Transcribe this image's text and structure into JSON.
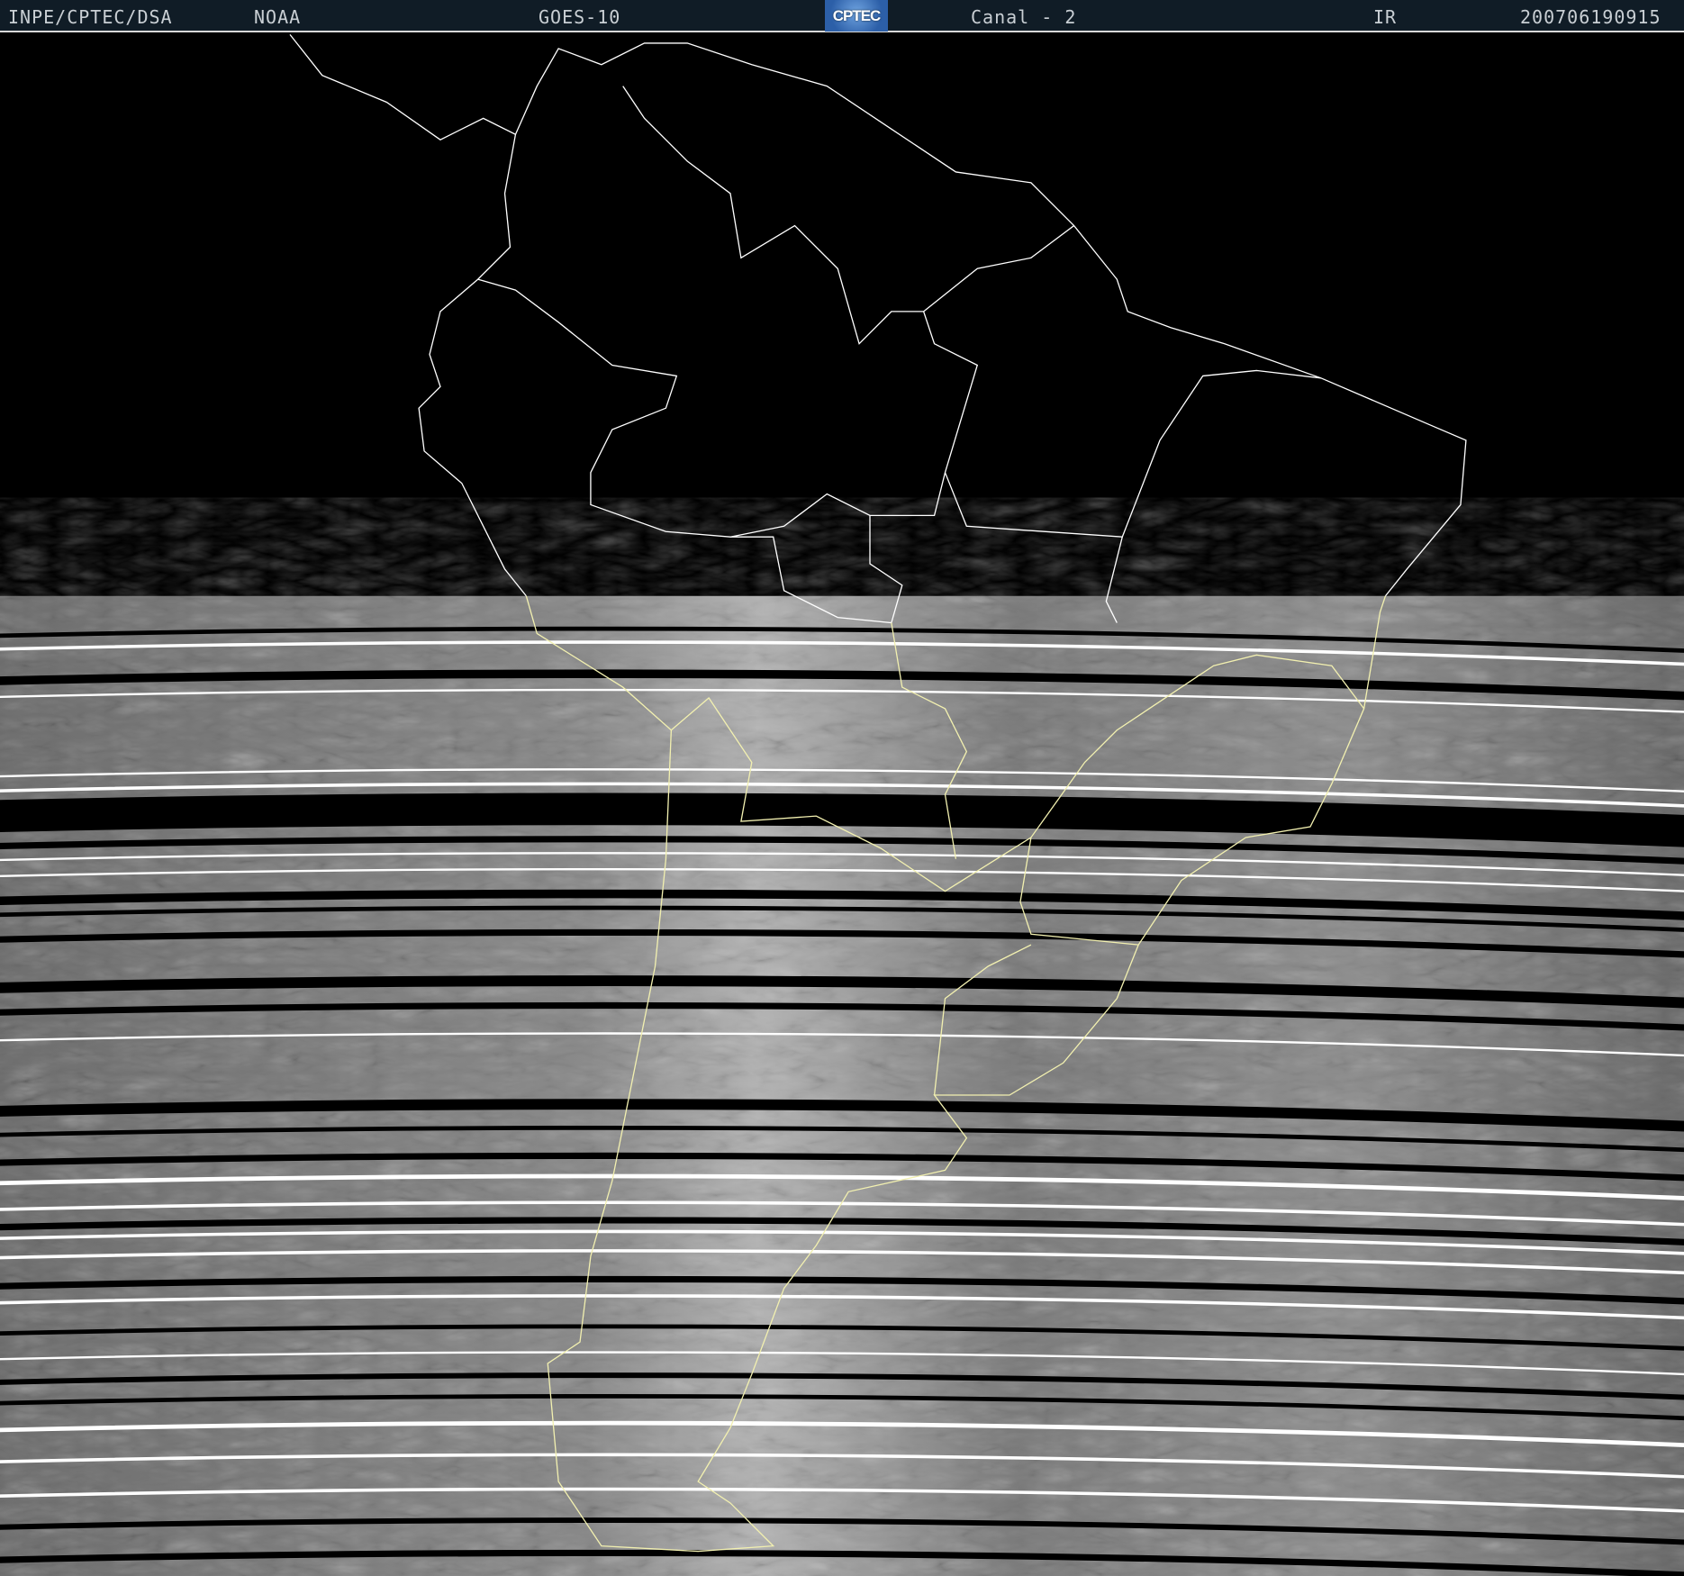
{
  "header": {
    "institution": "INPE/CPTEC/DSA",
    "agency": "NOAA",
    "satellite": "GOES-10",
    "logo_text": "CPTEC",
    "channel": "Canal - 2",
    "band": "IR",
    "timestamp": "200706190915"
  },
  "colors": {
    "header_bg": "#101c26",
    "coastline_north": "#ffffff",
    "coastline_south": "#f2f0b0"
  }
}
